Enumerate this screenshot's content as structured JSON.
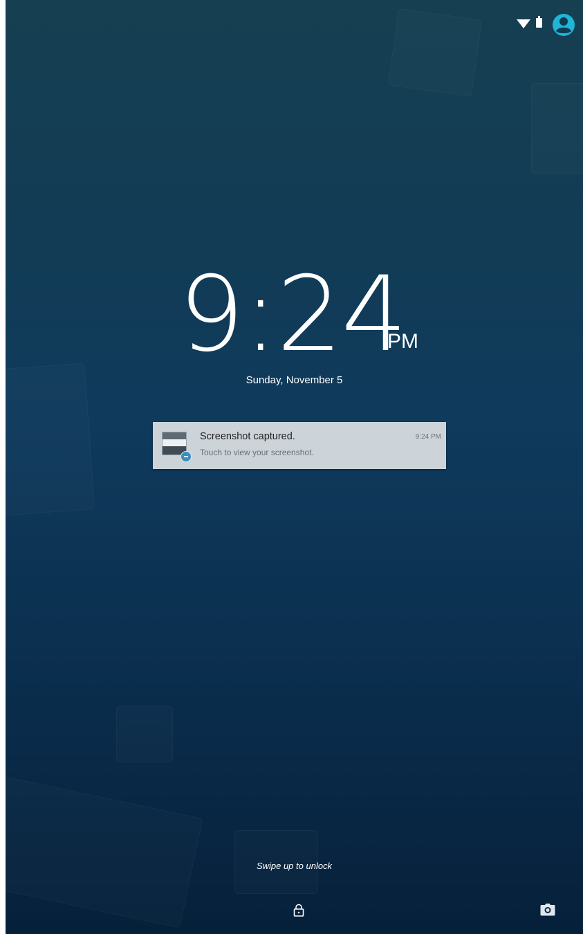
{
  "status_bar": {
    "icons": [
      "wifi-icon",
      "battery-icon",
      "user-icon"
    ],
    "accent_color": "#1fb5d6"
  },
  "clock": {
    "time": "9:24",
    "ampm": "PM",
    "date": "Sunday, November 5"
  },
  "notification": {
    "title": "Screenshot captured.",
    "body": "Touch to view your screenshot.",
    "time": "9:24 PM",
    "icon": "screenshot-thumbnail"
  },
  "lockscreen": {
    "unlock_hint": "Swipe up to unlock",
    "bottom_icons": [
      "lock-icon",
      "camera-icon"
    ]
  }
}
